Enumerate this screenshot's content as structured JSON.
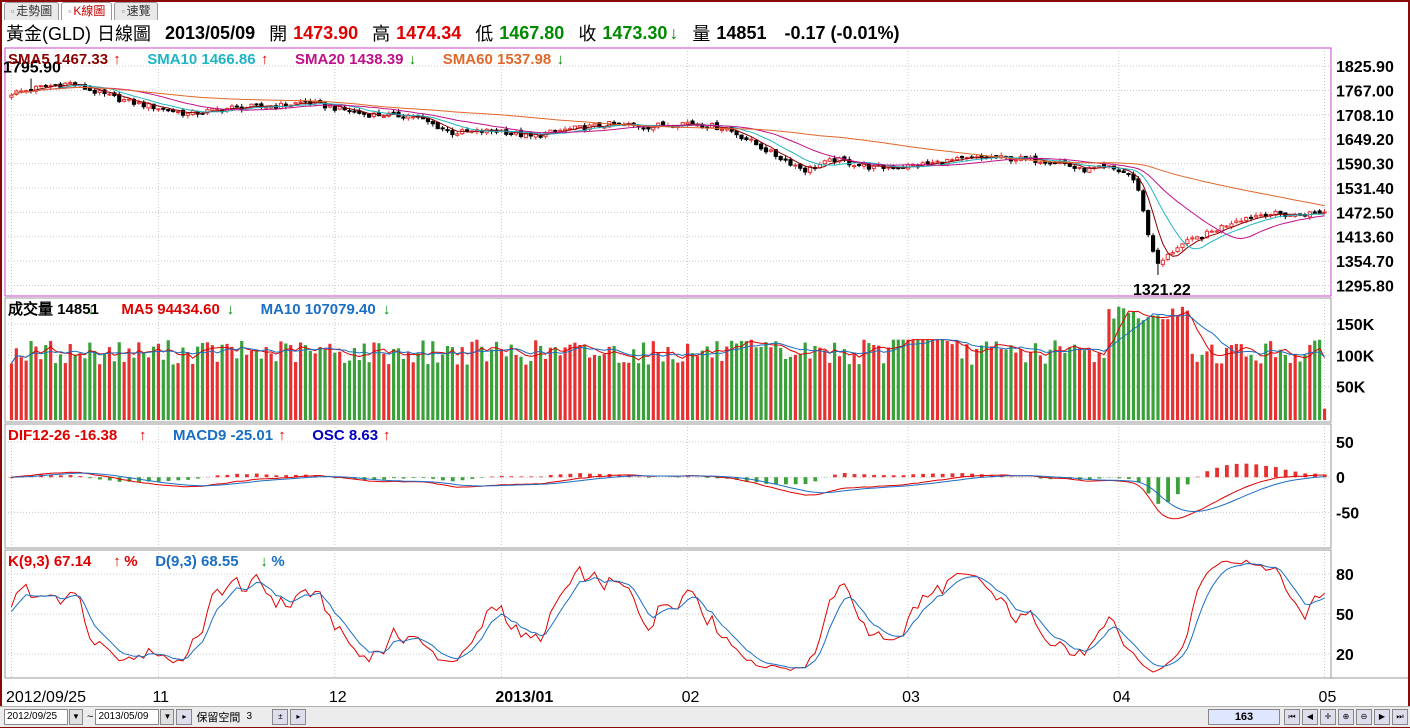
{
  "tabs": [
    {
      "label": "走勢圖"
    },
    {
      "label": "K線圖"
    },
    {
      "label": "速覽"
    }
  ],
  "quote": {
    "name": "黃金(GLD)",
    "period": "日線圖",
    "date": "2013/05/09",
    "open_label": "開",
    "open": "1473.90",
    "high_label": "高",
    "high": "1474.34",
    "low_label": "低",
    "low": "1467.80",
    "close_label": "收",
    "close": "1473.30",
    "close_arrow": "↓",
    "vol_label": "量",
    "vol": "14851",
    "change": "-0.17 (-0.01%)"
  },
  "legends": {
    "price": [
      {
        "text": "SMA5 1467.33",
        "arrow": "↑",
        "color": "#8b0000"
      },
      {
        "text": "SMA10 1466.86",
        "arrow": "↑",
        "color": "#1fb5c4"
      },
      {
        "text": "SMA20 1438.39",
        "arrow": "↓",
        "color": "#c0108a"
      },
      {
        "text": "SMA60 1537.98",
        "arrow": "↓",
        "color": "#e0682a"
      }
    ],
    "volume": [
      {
        "text": "成交量 14851",
        "arrow": "↓",
        "color": "#000000"
      },
      {
        "text": "MA5 94434.60",
        "arrow": "↓",
        "color": "#e00000"
      },
      {
        "text": "MA10 107079.40",
        "arrow": "↓",
        "color": "#1a6fc4"
      }
    ],
    "macd": [
      {
        "text": "DIF12-26 -16.38",
        "arrow": "↑",
        "color": "#e00000"
      },
      {
        "text": "MACD9 -25.01",
        "arrow": "↑",
        "color": "#1a6fc4"
      },
      {
        "text": "OSC 8.63",
        "arrow": "↑",
        "color": "#0000c0"
      }
    ],
    "kd": [
      {
        "text": "K(9,3) 67.14",
        "arrow": "↑",
        "suffix": "%",
        "color": "#e00000"
      },
      {
        "text": "D(9,3) 68.55",
        "arrow": "↓",
        "suffix": "%",
        "color": "#1a6fc4"
      }
    ]
  },
  "colors": {
    "up": "#e83030",
    "down": "#000000",
    "vol_up": "#e83030",
    "vol_down": "#3aa03a",
    "frame": "#8a0a0a",
    "price_border": "#cc44cc",
    "grid": "#c8c8c8"
  },
  "chart_data": [
    {
      "type": "candlestick",
      "title": "黃金(GLD) 日線圖",
      "yaxis_ticks": [
        "1825.90",
        "1767.00",
        "1708.10",
        "1649.20",
        "1590.30",
        "1531.40",
        "1472.50",
        "1413.60",
        "1354.70",
        "1295.80"
      ],
      "ylim": [
        1280,
        1860
      ],
      "annotations": [
        {
          "label": "1795.90",
          "value": 1795.9
        },
        {
          "label": "1321.22",
          "value": 1321.22
        }
      ],
      "x_ticks": [
        "2012/09/25",
        "11",
        "12",
        "2013/01",
        "02",
        "03",
        "04",
        "05"
      ],
      "close_anchors": [
        [
          0,
          1760
        ],
        [
          6,
          1775
        ],
        [
          12,
          1785
        ],
        [
          18,
          1760
        ],
        [
          24,
          1740
        ],
        [
          30,
          1725
        ],
        [
          36,
          1710
        ],
        [
          45,
          1725
        ],
        [
          55,
          1730
        ],
        [
          60,
          1740
        ],
        [
          66,
          1725
        ],
        [
          72,
          1710
        ],
        [
          82,
          1705
        ],
        [
          90,
          1665
        ],
        [
          100,
          1670
        ],
        [
          106,
          1655
        ],
        [
          112,
          1670
        ],
        [
          122,
          1685
        ],
        [
          130,
          1680
        ],
        [
          138,
          1690
        ],
        [
          146,
          1675
        ],
        [
          150,
          1650
        ],
        [
          156,
          1610
        ],
        [
          162,
          1575
        ],
        [
          168,
          1600
        ],
        [
          176,
          1580
        ],
        [
          184,
          1585
        ],
        [
          192,
          1598
        ],
        [
          200,
          1605
        ],
        [
          208,
          1600
        ],
        [
          214,
          1595
        ],
        [
          218,
          1575
        ],
        [
          224,
          1580
        ],
        [
          228,
          1565
        ],
        [
          230,
          1530
        ],
        [
          232,
          1420
        ],
        [
          234,
          1345
        ],
        [
          238,
          1390
        ],
        [
          244,
          1420
        ],
        [
          250,
          1455
        ],
        [
          256,
          1470
        ],
        [
          262,
          1465
        ],
        [
          266,
          1472
        ],
        [
          268,
          1473.3
        ]
      ],
      "sma5_last": 1467.33,
      "sma10_last": 1466.86,
      "sma20_last": 1438.39,
      "sma60_last": 1537.98
    },
    {
      "type": "bar",
      "title": "成交量",
      "yaxis_ticks": [
        "150K",
        "100K",
        "50K"
      ],
      "ylim": [
        0,
        185000
      ],
      "last_volume": 14851,
      "ma5_last": 94434.6,
      "ma10_last": 107079.4
    },
    {
      "type": "bar",
      "title": "MACD",
      "yaxis_ticks": [
        "50",
        "0",
        "-50"
      ],
      "ylim": [
        -95,
        70
      ],
      "dif_last": -16.38,
      "macd_last": -25.01,
      "osc_last": 8.63
    },
    {
      "type": "line",
      "title": "KD",
      "yaxis_ticks": [
        "80",
        "50",
        "20"
      ],
      "ylim": [
        5,
        95
      ],
      "k_last": 67.14,
      "d_last": 68.55
    }
  ],
  "bottombar": {
    "from_date": "2012/09/25",
    "tilde": "~",
    "to_date": "2013/05/09",
    "reserve_label": "保留空間",
    "reserve_value": "3",
    "count": "163"
  }
}
